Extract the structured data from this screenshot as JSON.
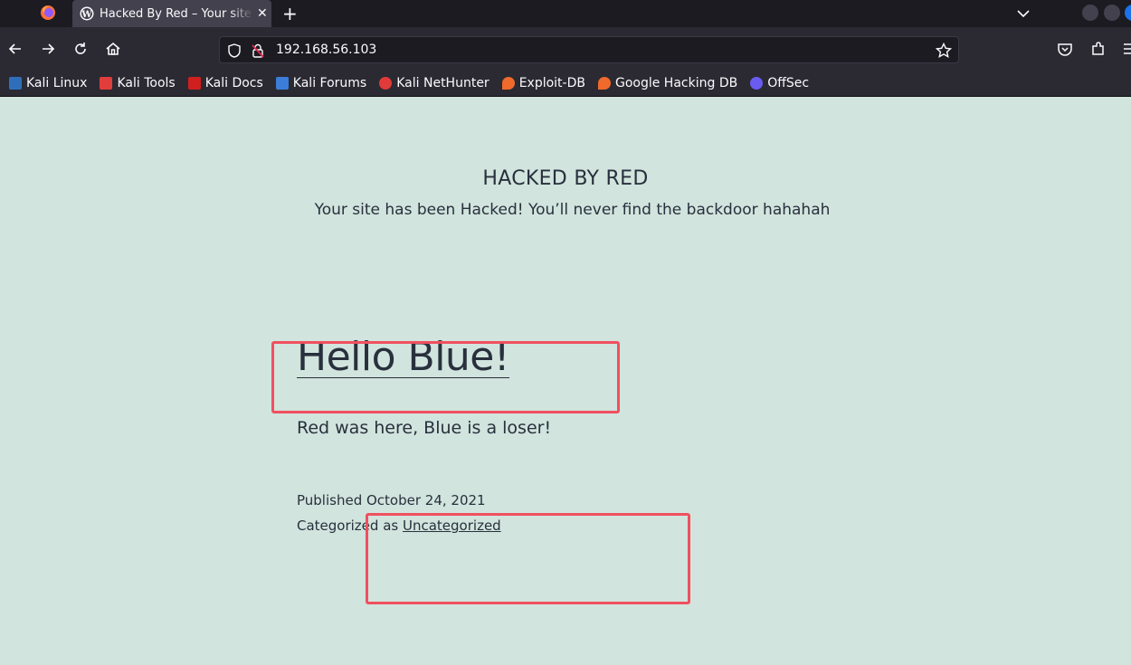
{
  "browser": {
    "tab": {
      "title": "Hacked By Red – Your site has been Hacked!",
      "close": "✕"
    },
    "newtab_label": "+",
    "url": "192.168.56.103",
    "bookmarks": [
      {
        "label": "Kali Linux",
        "icon": "kali-dragon-icon",
        "color": "#2f6fba"
      },
      {
        "label": "Kali Tools",
        "icon": "kali-tools-icon",
        "color": "#e23d3d"
      },
      {
        "label": "Kali Docs",
        "icon": "kali-docs-icon",
        "color": "#d01f1f"
      },
      {
        "label": "Kali Forums",
        "icon": "kali-forums-icon",
        "color": "#3b7dd8"
      },
      {
        "label": "Kali NetHunter",
        "icon": "nethunter-icon",
        "color": "#e03a3a"
      },
      {
        "label": "Exploit-DB",
        "icon": "exploit-db-icon",
        "color": "#f06a2c"
      },
      {
        "label": "Google Hacking DB",
        "icon": "ghdb-icon",
        "color": "#f06a2c"
      },
      {
        "label": "OffSec",
        "icon": "offsec-icon",
        "color": "#6a5cf0"
      }
    ]
  },
  "site": {
    "title": "HACKED BY RED",
    "description": "Your site has been Hacked! You’ll never find the backdoor hahahah"
  },
  "post": {
    "title": "Hello Blue!",
    "body": "Red was here, Blue is a loser!",
    "published_label": "Published",
    "published_date": "October 24, 2021",
    "category_prefix": "Categorized as",
    "category": "Uncategorized"
  },
  "colors": {
    "page_background": "#d1e4dd",
    "text": "#28303d",
    "annotation": "#f05060"
  }
}
